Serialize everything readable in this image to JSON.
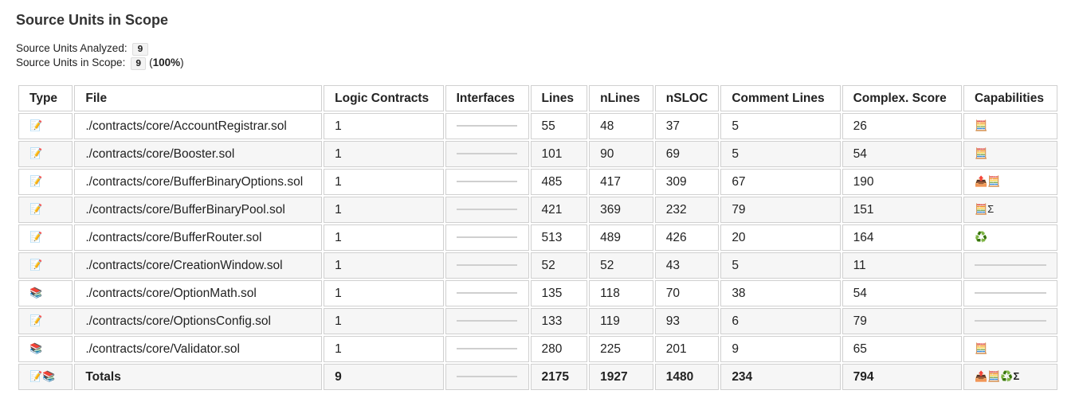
{
  "page": {
    "title": "Source Units in Scope",
    "summary": {
      "analyzed_label": "Source Units Analyzed:",
      "analyzed_value": "9",
      "scope_label": "Source Units in Scope:",
      "scope_value": "9",
      "scope_pct": "100%"
    }
  },
  "table": {
    "headers": [
      "Type",
      "File",
      "Logic Contracts",
      "Interfaces",
      "Lines",
      "nLines",
      "nSLOC",
      "Comment Lines",
      "Complex. Score",
      "Capabilities"
    ],
    "rows": [
      {
        "type": "📝",
        "file": "./contracts/core/AccountRegistrar.sol",
        "logic": "1",
        "lines": "55",
        "nlines": "48",
        "nsloc": "37",
        "comments": "5",
        "complex": "26",
        "caps": "🧮"
      },
      {
        "type": "📝",
        "file": "./contracts/core/Booster.sol",
        "logic": "1",
        "lines": "101",
        "nlines": "90",
        "nsloc": "69",
        "comments": "5",
        "complex": "54",
        "caps": "🧮"
      },
      {
        "type": "📝",
        "file": "./contracts/core/BufferBinaryOptions.sol",
        "logic": "1",
        "lines": "485",
        "nlines": "417",
        "nsloc": "309",
        "comments": "67",
        "complex": "190",
        "caps": "📤🧮"
      },
      {
        "type": "📝",
        "file": "./contracts/core/BufferBinaryPool.sol",
        "logic": "1",
        "lines": "421",
        "nlines": "369",
        "nsloc": "232",
        "comments": "79",
        "complex": "151",
        "caps": "🧮Σ"
      },
      {
        "type": "📝",
        "file": "./contracts/core/BufferRouter.sol",
        "logic": "1",
        "lines": "513",
        "nlines": "489",
        "nsloc": "426",
        "comments": "20",
        "complex": "164",
        "caps": "♻️"
      },
      {
        "type": "📝",
        "file": "./contracts/core/CreationWindow.sol",
        "logic": "1",
        "lines": "52",
        "nlines": "52",
        "nsloc": "43",
        "comments": "5",
        "complex": "11",
        "caps": ""
      },
      {
        "type": "📚",
        "file": "./contracts/core/OptionMath.sol",
        "logic": "1",
        "lines": "135",
        "nlines": "118",
        "nsloc": "70",
        "comments": "38",
        "complex": "54",
        "caps": ""
      },
      {
        "type": "📝",
        "file": "./contracts/core/OptionsConfig.sol",
        "logic": "1",
        "lines": "133",
        "nlines": "119",
        "nsloc": "93",
        "comments": "6",
        "complex": "79",
        "caps": ""
      },
      {
        "type": "📚",
        "file": "./contracts/core/Validator.sol",
        "logic": "1",
        "lines": "280",
        "nlines": "225",
        "nsloc": "201",
        "comments": "9",
        "complex": "65",
        "caps": "🧮"
      }
    ],
    "totals": {
      "type": "📝📚",
      "label": "Totals",
      "logic": "9",
      "lines": "2175",
      "nlines": "1927",
      "nsloc": "1480",
      "comments": "234",
      "complex": "794",
      "caps": "📤🧮♻️Σ"
    }
  },
  "icons": {
    "contract": "memo-icon",
    "library": "books-icon",
    "empty_placeholder": "dash-line"
  }
}
